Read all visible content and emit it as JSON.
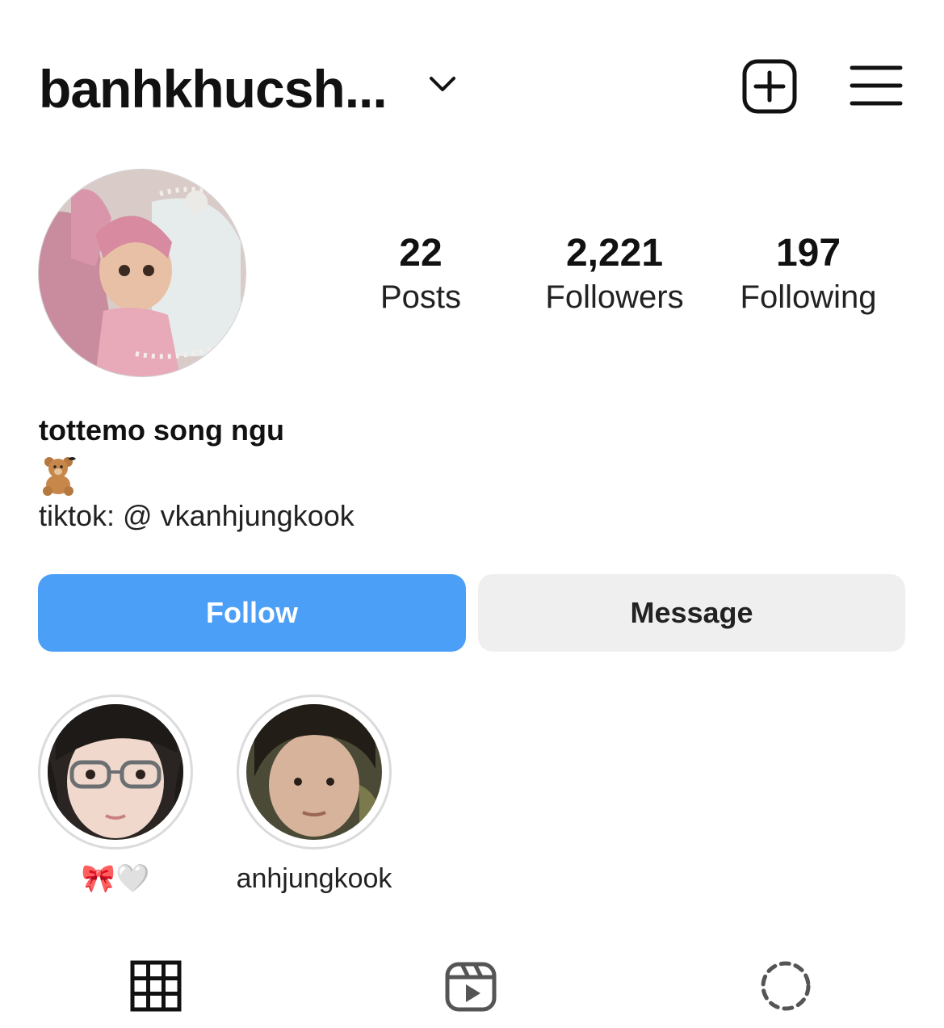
{
  "header": {
    "username": "banhkhucsh...",
    "dropdown_icon": "chevron-down-icon",
    "create_icon": "plus-square-icon",
    "menu_icon": "hamburger-menu-icon"
  },
  "stats": {
    "posts": {
      "value": "22",
      "label": "Posts"
    },
    "followers": {
      "value": "2,221",
      "label": "Followers"
    },
    "following": {
      "value": "197",
      "label": "Following"
    }
  },
  "bio": {
    "name": "tottemo song ngu",
    "emoji": "teddy-bear-icon",
    "text": "tiktok: @ vkanhjungkook"
  },
  "actions": {
    "follow_label": "Follow",
    "message_label": "Message"
  },
  "highlights": [
    {
      "label": "🎀🤍"
    },
    {
      "label": "anhjungkook"
    }
  ],
  "tabs": {
    "grid": "grid-icon",
    "reels": "reels-icon",
    "tagged": "tagged-icon"
  },
  "colors": {
    "follow_button": "#4c9ff6",
    "message_button": "#efefef",
    "text": "#111111"
  }
}
